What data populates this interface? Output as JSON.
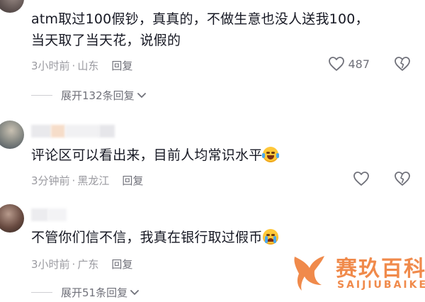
{
  "comments": [
    {
      "text_lines": [
        "atm取过100假钞，真真的，不做生意也没人送我100，",
        "当天取了当天花，说假的"
      ],
      "time": "3小时前",
      "separator": "·",
      "location": "山东",
      "reply_label": "回复",
      "likes": "487",
      "expand_label": "展开132条回复"
    },
    {
      "text": "评论区可以看出来，目前人均常识水平",
      "emoji": "laughing-crying-emoji",
      "time": "3分钟前",
      "separator": "·",
      "location": "黑龙江",
      "reply_label": "回复"
    },
    {
      "text": "不管你们信不信，我真在银行取过假币",
      "emoji": "crying-emoji",
      "time": "3小时前",
      "separator": "·",
      "location": "广东",
      "reply_label": "回复",
      "expand_label": "展开51条回复"
    }
  ],
  "icons": {
    "like": "heart-outline-icon",
    "dislike": "broken-heart-outline-icon",
    "expand": "chevron-down-icon"
  },
  "watermark": {
    "cn": "赛玖百科",
    "en": "SAIJIUBAIKE"
  },
  "colors": {
    "text": "#161823",
    "meta": "#9a9aa0",
    "action": "#70717a",
    "watermark": "#f08a4b"
  }
}
